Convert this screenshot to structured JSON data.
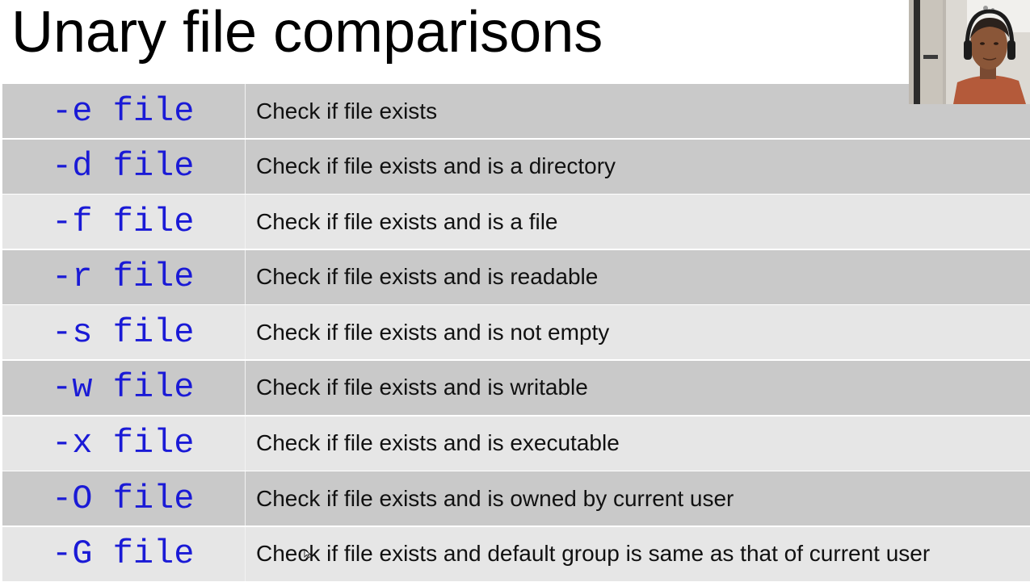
{
  "slide": {
    "title": "Unary file comparisons"
  },
  "rows": [
    {
      "flag": "-e file",
      "description": "Check if file exists"
    },
    {
      "flag": "-d file",
      "description": "Check if file exists and is a directory"
    },
    {
      "flag": "-f file",
      "description": "Check if file exists and is a file"
    },
    {
      "flag": "-r file",
      "description": "Check if file exists and is readable"
    },
    {
      "flag": "-s file",
      "description": "Check if file exists and is not empty"
    },
    {
      "flag": "-w file",
      "description": "Check if file exists and is writable"
    },
    {
      "flag": "-x file",
      "description": "Check if file exists and is executable"
    },
    {
      "flag": "-O file",
      "description": "Check if file exists and is owned by current user"
    },
    {
      "flag": "-G file",
      "description": "Check if file exists and default group is same as that of current user"
    }
  ],
  "colors": {
    "flag_text": "#1a1ad6",
    "row_dark": "#c9c9c9",
    "row_light": "#e6e6e6"
  },
  "icons": {
    "webcam": "presenter-webcam-thumbnail",
    "cursor": "mouse-pointer-icon"
  }
}
